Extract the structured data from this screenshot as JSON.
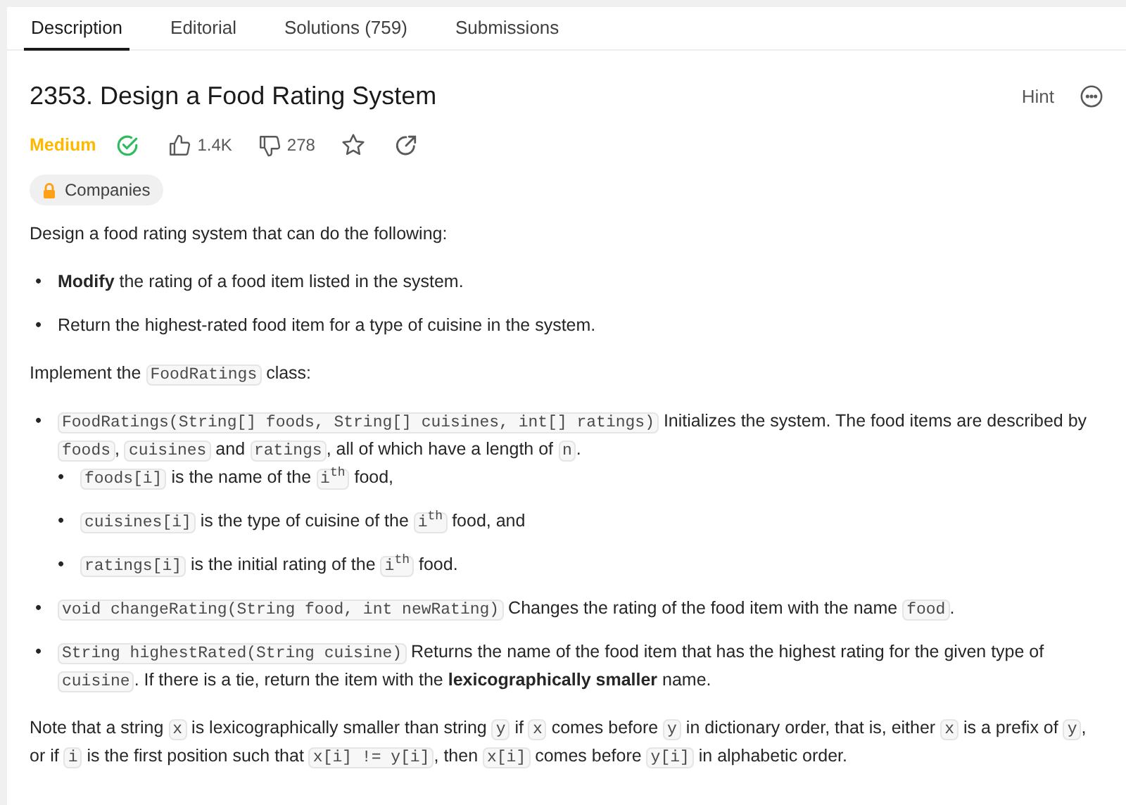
{
  "tabs": [
    {
      "label": "Description",
      "selected": true
    },
    {
      "label": "Editorial",
      "selected": false
    },
    {
      "label": "Solutions (759)",
      "selected": false
    },
    {
      "label": "Submissions",
      "selected": false
    }
  ],
  "title": "2353. Design a Food Rating System",
  "hint": "Hint",
  "difficulty": "Medium",
  "solved": true,
  "likes": "1.4K",
  "dislikes": "278",
  "companies": "Companies",
  "body": [
    {
      "kind": "para",
      "segments": [
        {
          "kind": "text",
          "text": "Design a food rating system that can do the following:"
        }
      ]
    },
    {
      "kind": "list",
      "items": [
        {
          "bullet": "•",
          "segments": [
            {
              "kind": "text",
              "text": "**Modify** the rating of a food item listed in the system."
            }
          ]
        },
        {
          "bullet": "•",
          "segments": [
            {
              "kind": "text",
              "text": "Return the highest-rated food item for a type of cuisine in the system."
            }
          ]
        }
      ]
    },
    {
      "kind": "para",
      "segments": [
        {
          "kind": "text",
          "text": "Implement the"
        },
        {
          "kind": "code",
          "text": "FoodRatings"
        },
        {
          "kind": "text",
          "text": "class:"
        }
      ]
    },
    {
      "kind": "list",
      "items": [
        {
          "bullet": "•",
          "segments": [
            {
              "kind": "code",
              "text": "FoodRatings(String[] foods, String[] cuisines, int[] ratings)"
            },
            {
              "kind": "text",
              "text": "Initializes the system. The food items are described by"
            },
            {
              "kind": "code",
              "text": "foods"
            },
            {
              "kind": "text",
              "text": ","
            },
            {
              "kind": "code",
              "text": "cuisines"
            },
            {
              "kind": "text",
              "text": "and"
            },
            {
              "kind": "code",
              "text": "ratings"
            },
            {
              "kind": "text",
              "text": ", all of which have a length of"
            },
            {
              "kind": "code",
              "text": "n"
            },
            {
              "kind": "text",
              "text": "."
            }
          ],
          "children": [
            {
              "bullet": "•",
              "segments": [
                {
                  "kind": "code",
                  "text": "foods[i]"
                },
                {
                  "kind": "text",
                  "text": "is the name of the"
                },
                {
                  "kind": "code",
                  "text": "i$^{th}$"
                },
                {
                  "kind": "text",
                  "text": "food,"
                }
              ]
            },
            {
              "bullet": "•",
              "segments": [
                {
                  "kind": "code",
                  "text": "cuisines[i]"
                },
                {
                  "kind": "text",
                  "text": "is the type of cuisine of the"
                },
                {
                  "kind": "code",
                  "text": "i$^{th}$"
                },
                {
                  "kind": "text",
                  "text": "food, and"
                }
              ]
            },
            {
              "bullet": "•",
              "segments": [
                {
                  "kind": "code",
                  "text": "ratings[i]"
                },
                {
                  "kind": "text",
                  "text": "is the initial rating of the"
                },
                {
                  "kind": "code",
                  "text": "i$^{th}$"
                },
                {
                  "kind": "text",
                  "text": "food."
                }
              ]
            }
          ]
        },
        {
          "bullet": "•",
          "segments": [
            {
              "kind": "code",
              "text": "void changeRating(String food, int newRating)"
            },
            {
              "kind": "text",
              "text": "Changes the rating of the food item with the name"
            },
            {
              "kind": "code",
              "text": "food"
            },
            {
              "kind": "text",
              "text": "."
            }
          ]
        },
        {
          "bullet": "•",
          "segments": [
            {
              "kind": "code",
              "text": "String highestRated(String cuisine)"
            },
            {
              "kind": "text",
              "text": "Returns the name of the food item that has the highest rating for the given type of"
            },
            {
              "kind": "code",
              "text": "cuisine"
            },
            {
              "kind": "text",
              "text": ". If there is a tie, return the item with the **lexicographically smaller** name."
            }
          ]
        }
      ]
    },
    {
      "kind": "para",
      "segments": [
        {
          "kind": "text",
          "text": "Note that a string"
        },
        {
          "kind": "code",
          "text": "x"
        },
        {
          "kind": "text",
          "text": "is lexicographically smaller than string"
        },
        {
          "kind": "code",
          "text": "y"
        },
        {
          "kind": "text",
          "text": "if"
        },
        {
          "kind": "code",
          "text": "x"
        },
        {
          "kind": "text",
          "text": "comes before"
        },
        {
          "kind": "code",
          "text": "y"
        },
        {
          "kind": "text",
          "text": "in dictionary order, that is, either"
        },
        {
          "kind": "code",
          "text": "x"
        },
        {
          "kind": "text",
          "text": "is a prefix of"
        },
        {
          "kind": "code",
          "text": "y"
        },
        {
          "kind": "text",
          "text": ", or if"
        },
        {
          "kind": "code",
          "text": "i"
        },
        {
          "kind": "text",
          "text": "is the first position such that"
        },
        {
          "kind": "code",
          "text": "x[i] != y[i]"
        },
        {
          "kind": "text",
          "text": ", then"
        },
        {
          "kind": "code",
          "text": "x[i]"
        },
        {
          "kind": "text",
          "text": "comes before"
        },
        {
          "kind": "code",
          "text": "y[i]"
        },
        {
          "kind": "text",
          "text": "in alphabetic order."
        }
      ]
    }
  ]
}
